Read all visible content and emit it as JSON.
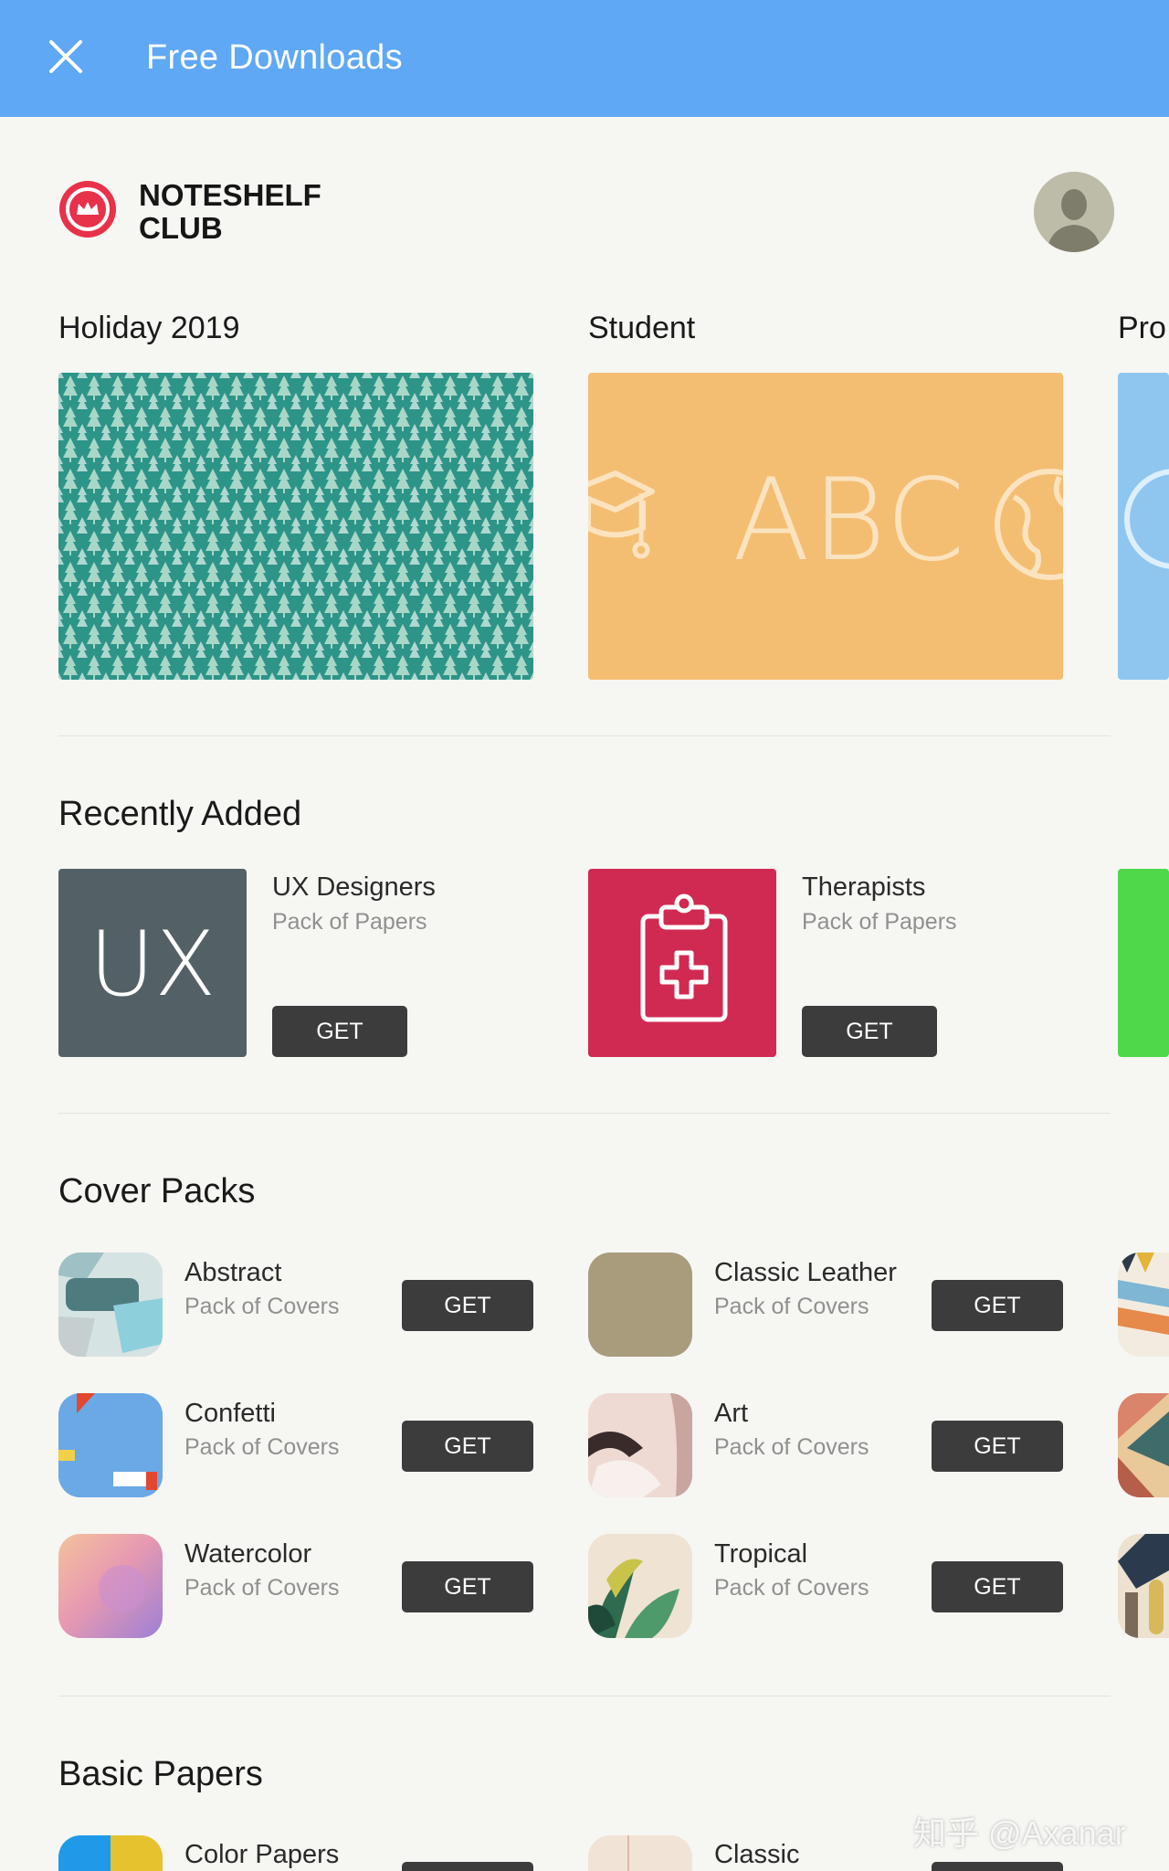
{
  "topbar": {
    "title": "Free Downloads",
    "color": "#5fa8f5"
  },
  "club": {
    "line1": "NOTESHELF",
    "line2": "CLUB",
    "logo_icon": "crown-badge-icon"
  },
  "categories": [
    {
      "label": "Holiday 2019"
    },
    {
      "label": "Student",
      "card_text": "ABC"
    },
    {
      "label": "Pro"
    }
  ],
  "recently_added": {
    "title": "Recently Added",
    "items": [
      {
        "name": "UX Designers",
        "subtitle": "Pack of Papers",
        "thumb_text": "UX",
        "get": "GET"
      },
      {
        "name": "Therapists",
        "subtitle": "Pack of Papers",
        "thumb_icon": "clipboard-plus-icon",
        "get": "GET"
      }
    ]
  },
  "cover_packs": {
    "title": "Cover Packs",
    "items": [
      {
        "name": "Abstract",
        "subtitle": "Pack of Covers",
        "get": "GET"
      },
      {
        "name": "Classic Leather",
        "subtitle": "Pack of Covers",
        "get": "GET"
      },
      {
        "name": "Confetti",
        "subtitle": "Pack of Covers",
        "get": "GET"
      },
      {
        "name": "Art",
        "subtitle": "Pack of Covers",
        "get": "GET"
      },
      {
        "name": "Watercolor",
        "subtitle": "Pack of Covers",
        "get": "GET"
      },
      {
        "name": "Tropical",
        "subtitle": "Pack of Covers",
        "get": "GET"
      }
    ]
  },
  "basic_papers": {
    "title": "Basic Papers",
    "items": [
      {
        "name": "Color Papers"
      },
      {
        "name": "Classic"
      }
    ]
  },
  "watermark": "知乎 @Axanar"
}
